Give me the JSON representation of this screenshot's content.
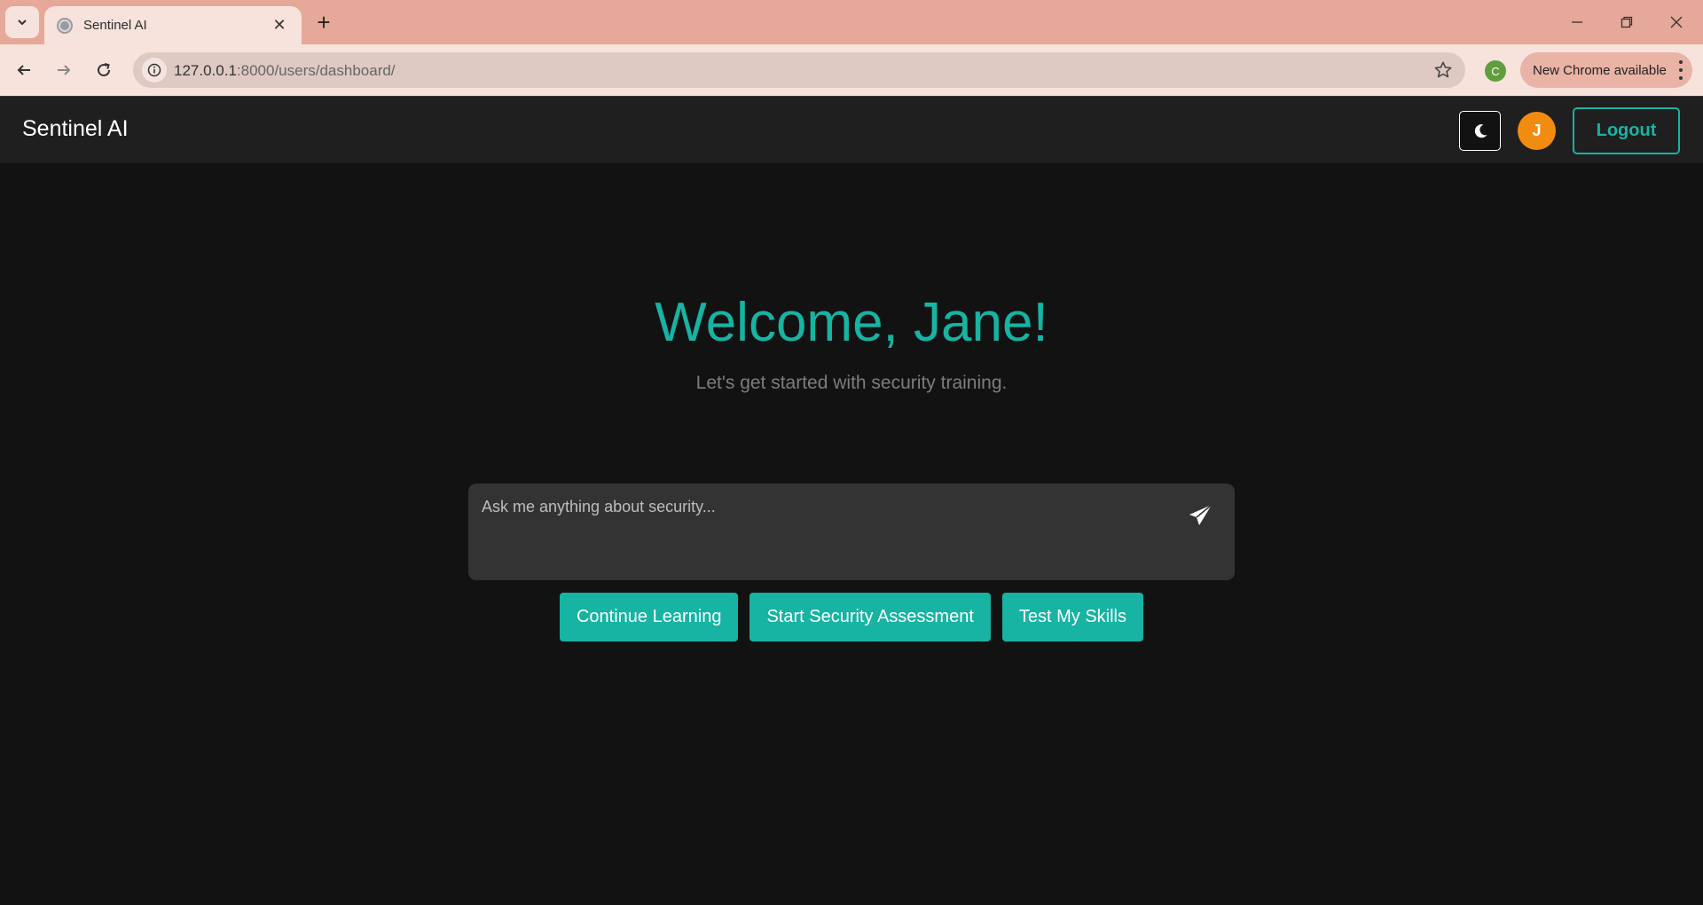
{
  "browser": {
    "tab_title": "Sentinel AI",
    "url_host": "127.0.0.1",
    "url_rest": ":8000/users/dashboard/",
    "profile_initial": "C",
    "update_label": "New Chrome available",
    "icons": [
      "tab-search-icon",
      "globe-icon",
      "close-icon",
      "plus-icon",
      "minimize-icon",
      "restore-icon",
      "window-close-icon",
      "back-icon",
      "forward-icon",
      "reload-icon",
      "site-info-icon",
      "star-icon",
      "more-vert-icon"
    ]
  },
  "app": {
    "brand": "Sentinel AI",
    "avatar_initial": "J",
    "logout_label": "Logout",
    "colors": {
      "accent": "#17b3a3",
      "avatar": "#f28c11",
      "background": "#121212",
      "navbar": "#1f1f1f",
      "input": "#333333"
    }
  },
  "main": {
    "welcome": "Welcome, Jane!",
    "subtitle": "Let's get started with security training.",
    "chat_placeholder": "Ask me anything about security...",
    "actions": [
      {
        "label": "Continue Learning"
      },
      {
        "label": "Start Security Assessment"
      },
      {
        "label": "Test My Skills"
      }
    ]
  }
}
